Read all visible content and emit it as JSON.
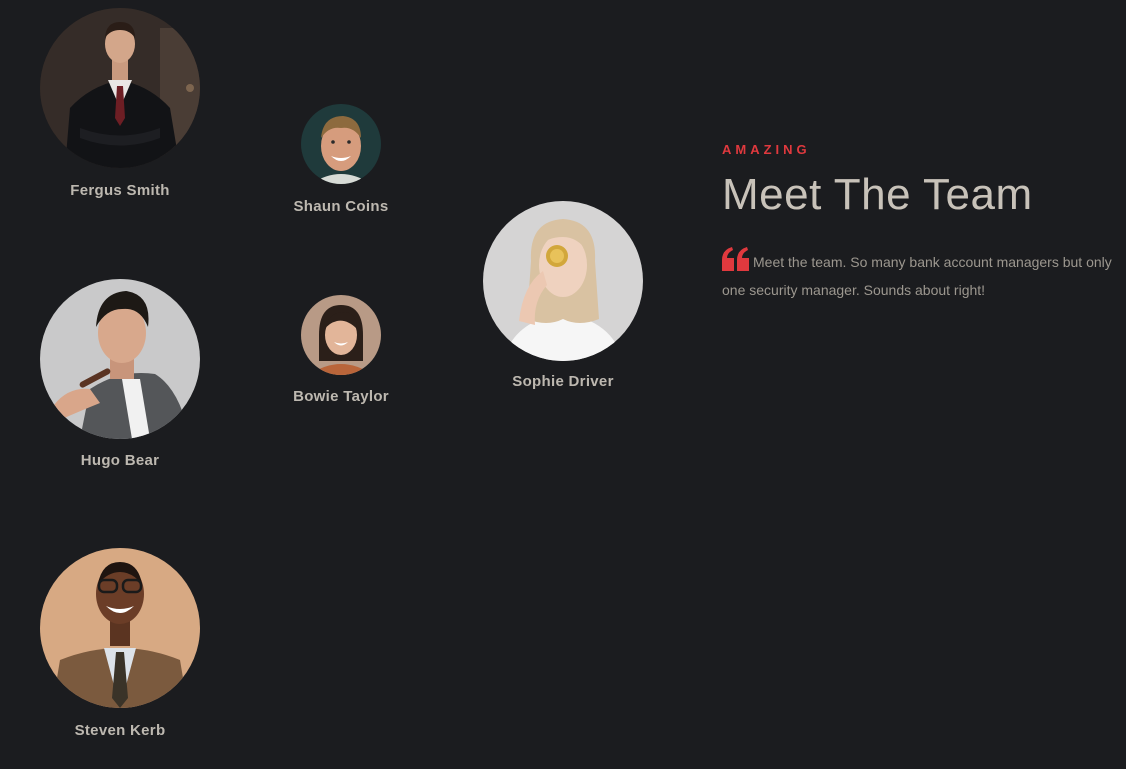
{
  "team": {
    "members": [
      {
        "name": "Fergus Smith"
      },
      {
        "name": "Shaun Coins"
      },
      {
        "name": "Hugo Bear"
      },
      {
        "name": "Bowie Taylor"
      },
      {
        "name": "Sophie Driver"
      },
      {
        "name": "Steven Kerb"
      }
    ]
  },
  "intro": {
    "eyebrow": "AMAZING",
    "title": "Meet The Team",
    "quote": "Meet the team. So many bank account managers but only one security manager. Sounds about right!",
    "quote_icon": "quote-left-icon"
  },
  "colors": {
    "background": "#1b1c1f",
    "accent": "#e0393e",
    "title": "#c8c2b9",
    "body_text": "#9c978f",
    "name_text": "#bdb8b0"
  }
}
